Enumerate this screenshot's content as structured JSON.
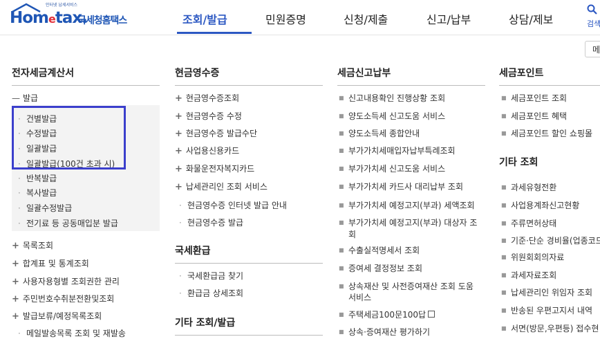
{
  "logo": {
    "tagline": "인터넷 납세서비스",
    "brand_pre": "Hom",
    "brand_e": "e",
    "brand_post": "tax.",
    "org": "국세청홈택스"
  },
  "nav": [
    "조회/발급",
    "민원증명",
    "신청/제출",
    "신고/납부",
    "상담/제보"
  ],
  "search_label": "검색",
  "more_button": "메",
  "col1": {
    "title": "전자세금계산서",
    "section": "발급",
    "sub": [
      "건별발급",
      "수정발급",
      "일괄발급",
      "일괄발급(100건 초과 시)",
      "반복발급",
      "복사발급",
      "일괄수정발급",
      "전기료 등 공동매입분 발급"
    ],
    "items": [
      "목록조회",
      "합계표 및 통계조회",
      "사용자용형별 조회권한 관리",
      "주민번호수취분전환및조회",
      "발급보류/예정목록조회",
      "메일발송목록 조회 및 재발송"
    ]
  },
  "col2": {
    "title": "현금영수증",
    "items": [
      "현금영수증조회",
      "현금영수증 수정",
      "현금영수증 발급수단",
      "사업용신용카드",
      "화물운전자복지카드",
      "납세관리인 조회 서비스"
    ],
    "dots": [
      "현금영수증 인터넷 발급 안내",
      "현금영수증 발급"
    ],
    "title2": "국세환급",
    "items2": [
      "국세환급금 찾기",
      "환급금 상세조회"
    ],
    "title3": "기타 조회/발급"
  },
  "col3": {
    "title": "세금신고납부",
    "items": [
      "신고내용확인 진행상황 조회",
      "양도소득세 신고도움 서비스",
      "양도소득세 종합안내",
      "부가가치세매입자납부특례조회",
      "부가가치세 신고도움 서비스",
      "부가가치세 카드사 대리납부 조회",
      "부가가치세 예정고지(부과) 세액조회",
      "부가가치세 예정고지(부과) 대상자 조",
      "회",
      "수출실적명세서 조회",
      "증여세 결정정보 조회",
      "상속재산 및 사전증여재산 조회 도움",
      "서비스",
      "주택세금100문100답",
      "상속·증여재산 평가하기"
    ]
  },
  "col4": {
    "title": "세금포인트",
    "items": [
      "세금포인트 조회",
      "세금포인트 혜택",
      "세금포인트 할인 쇼핑몰"
    ],
    "title2": "기타 조회",
    "items2": [
      "과세유형전환",
      "사업용계좌신고현황",
      "주류면허상태",
      "기준·단순 경비율(업종코드",
      "위원회회의자료",
      "과세자료조회",
      "납세관리인 위임자 조회",
      "반송된 우편고지서 내역",
      "서면(방문,우편등) 접수현"
    ]
  },
  "colors": {
    "accent": "#2b57c2",
    "highlight": "#3b3fcc"
  }
}
